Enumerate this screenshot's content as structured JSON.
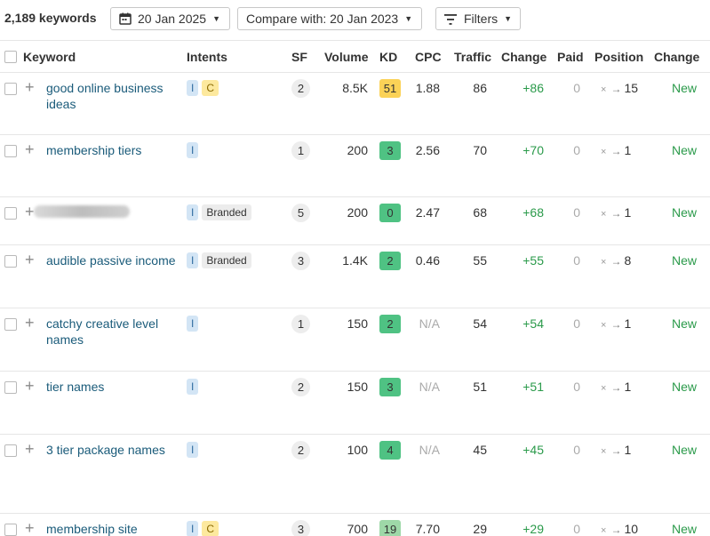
{
  "toolbar": {
    "keyword_count": "2,189 keywords",
    "date_label": "20 Jan 2025",
    "compare_label": "Compare with: 20 Jan 2023",
    "filters_label": "Filters"
  },
  "columns": {
    "keyword": "Keyword",
    "intents": "Intents",
    "sf": "SF",
    "volume": "Volume",
    "kd": "KD",
    "cpc": "CPC",
    "traffic": "Traffic",
    "change": "Change",
    "paid": "Paid",
    "position": "Position",
    "change2": "Change"
  },
  "rows": [
    {
      "keyword": "good online business ideas",
      "intents": [
        "I",
        "C"
      ],
      "sf": "2",
      "volume": "8.5K",
      "kd": "51",
      "kd_color": "#fbd257",
      "cpc": "1.88",
      "traffic": "86",
      "change": "+86",
      "paid": "0",
      "pos_from": "×",
      "pos_to": "15",
      "status": "New"
    },
    {
      "keyword": "membership tiers",
      "intents": [
        "I"
      ],
      "sf": "1",
      "volume": "200",
      "kd": "3",
      "kd_color": "#4fc283",
      "cpc": "2.56",
      "traffic": "70",
      "change": "+70",
      "paid": "0",
      "pos_from": "×",
      "pos_to": "1",
      "status": "New"
    },
    {
      "keyword": "",
      "intents": [
        "I",
        "Branded"
      ],
      "sf": "5",
      "volume": "200",
      "kd": "0",
      "kd_color": "#4fc283",
      "cpc": "2.47",
      "traffic": "68",
      "change": "+68",
      "paid": "0",
      "pos_from": "×",
      "pos_to": "1",
      "status": "New"
    },
    {
      "keyword": "audible passive income",
      "intents": [
        "I",
        "Branded"
      ],
      "sf": "3",
      "volume": "1.4K",
      "kd": "2",
      "kd_color": "#4fc283",
      "cpc": "0.46",
      "traffic": "55",
      "change": "+55",
      "paid": "0",
      "pos_from": "×",
      "pos_to": "8",
      "status": "New"
    },
    {
      "keyword": "catchy creative level names",
      "intents": [
        "I"
      ],
      "sf": "1",
      "volume": "150",
      "kd": "2",
      "kd_color": "#4fc283",
      "cpc": "N/A",
      "traffic": "54",
      "change": "+54",
      "paid": "0",
      "pos_from": "×",
      "pos_to": "1",
      "status": "New"
    },
    {
      "keyword": "tier names",
      "intents": [
        "I"
      ],
      "sf": "2",
      "volume": "150",
      "kd": "3",
      "kd_color": "#4fc283",
      "cpc": "N/A",
      "traffic": "51",
      "change": "+51",
      "paid": "0",
      "pos_from": "×",
      "pos_to": "1",
      "status": "New"
    },
    {
      "keyword": "3 tier package names",
      "intents": [
        "I"
      ],
      "sf": "2",
      "volume": "100",
      "kd": "4",
      "kd_color": "#4fc283",
      "cpc": "N/A",
      "traffic": "45",
      "change": "+45",
      "paid": "0",
      "pos_from": "×",
      "pos_to": "1",
      "status": "New"
    },
    {
      "keyword": "membership site",
      "intents": [
        "I",
        "C"
      ],
      "sf": "3",
      "volume": "700",
      "kd": "19",
      "kd_color": "#9ed8a8",
      "cpc": "7.70",
      "traffic": "29",
      "change": "+29",
      "paid": "0",
      "pos_from": "×",
      "pos_to": "10",
      "status": "New"
    }
  ]
}
